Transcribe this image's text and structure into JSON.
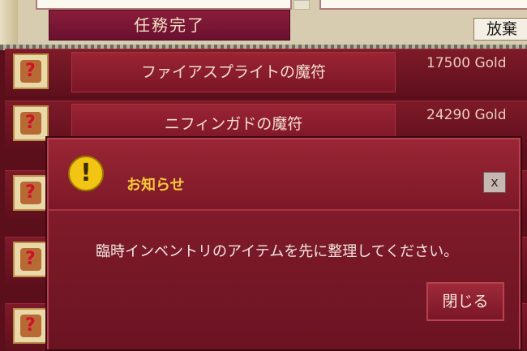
{
  "quest_panel": {
    "complete_label": "任務完了",
    "abandon_label": "放棄"
  },
  "items": [
    {
      "name": "ファイアスプライトの魔符",
      "price": "17500 Gold"
    },
    {
      "name": "ニフィンガドの魔符",
      "price": "24290 Gold"
    },
    {
      "name": "",
      "price": ""
    },
    {
      "name": "",
      "price": ""
    },
    {
      "name": "",
      "price": ""
    }
  ],
  "dialog": {
    "title": "お知らせ",
    "close_label": "x",
    "alert_symbol": "!",
    "message": "臨時インベントリのアイテムを先に整理してください。",
    "ok_label": "閉じる"
  },
  "colors": {
    "panel_bg": "#5a0f1a",
    "title_yellow": "#f6c93a",
    "alert_icon": "#f2c514"
  }
}
